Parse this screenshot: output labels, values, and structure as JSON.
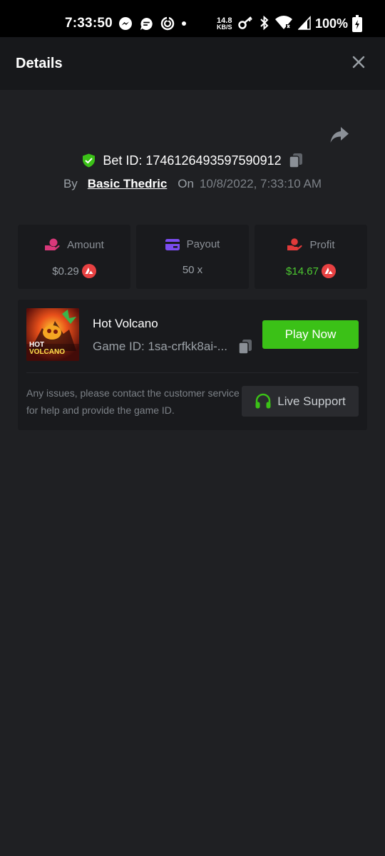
{
  "status_bar": {
    "time": "7:33:50",
    "net_speed_value": "14.8",
    "net_speed_unit": "KB/S",
    "battery": "100%",
    "left_icons": [
      "messenger-icon",
      "chat-icon",
      "sync-icon",
      "dot-icon"
    ],
    "right_icons": [
      "key-icon",
      "bluetooth-icon",
      "wifi-icon",
      "signal-icon",
      "battery-icon"
    ]
  },
  "header": {
    "title": "Details",
    "close_icon": "close-icon"
  },
  "bet": {
    "id_label": "Bet ID: 1746126493597590912",
    "by_label": "By",
    "user": "Basic Thedric",
    "on_label": "On",
    "date": "10/8/2022, 7:33:10 AM"
  },
  "stats": [
    {
      "label": "Amount",
      "value": "$0.29",
      "icon": "money-hand-icon",
      "color": "#d9387a",
      "coin": true
    },
    {
      "label": "Payout",
      "value": "50 x",
      "icon": "card-icon",
      "color": "#7b4cf0",
      "coin": false
    },
    {
      "label": "Profit",
      "value": "$14.67",
      "icon": "profit-hand-icon",
      "color": "#e03a3a",
      "coin": true
    }
  ],
  "game": {
    "name": "Hot Volcano",
    "id_label": "Game ID: 1sa-crfkk8ai-...",
    "thumb_text_1": "HOT",
    "thumb_text_2": "VOLCANO",
    "play_label": "Play Now"
  },
  "support": {
    "help_text": "Any issues, please contact the customer service for help and provide the game ID.",
    "button_label": "Live Support"
  },
  "colors": {
    "background": "#1f2023",
    "header": "#17181b",
    "card": "#191a1d",
    "accent_green": "#3bc117",
    "profit_green": "#4cc831",
    "coin_red": "#e84142"
  }
}
